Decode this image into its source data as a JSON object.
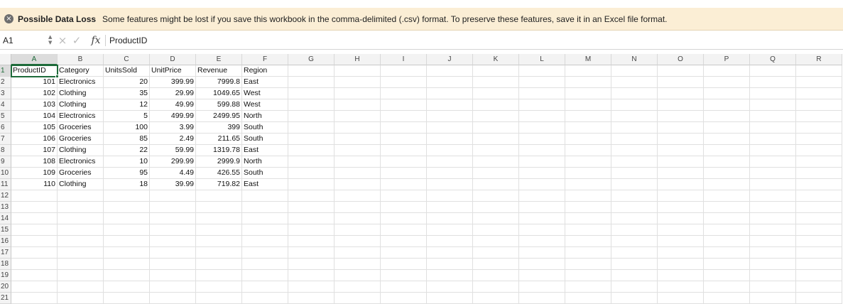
{
  "message_bar": {
    "icon": "close-circle-icon",
    "title": "Possible Data Loss",
    "text": "Some features might be lost if you save this workbook in the comma-delimited (.csv) format. To preserve these features, save it in an Excel file format."
  },
  "formula_bar": {
    "name_box": "A1",
    "cancel_icon": "×",
    "enter_icon": "✓",
    "fx_label": "fx",
    "content": "ProductID"
  },
  "columns": [
    "A",
    "B",
    "C",
    "D",
    "E",
    "F",
    "G",
    "H",
    "I",
    "J",
    "K",
    "L",
    "M",
    "N",
    "O",
    "P",
    "Q",
    "R"
  ],
  "rows": [
    "1",
    "2",
    "3",
    "4",
    "5",
    "6",
    "7",
    "8",
    "9",
    "10",
    "11",
    "12",
    "13",
    "14",
    "15",
    "16",
    "17",
    "18",
    "19",
    "20",
    "21"
  ],
  "table": {
    "headers": [
      "ProductID",
      "Category",
      "UnitsSold",
      "UnitPrice",
      "Revenue",
      "Region"
    ],
    "data": [
      [
        "101",
        "Electronics",
        "20",
        "399.99",
        "7999.8",
        "East"
      ],
      [
        "102",
        "Clothing",
        "35",
        "29.99",
        "1049.65",
        "West"
      ],
      [
        "103",
        "Clothing",
        "12",
        "49.99",
        "599.88",
        "West"
      ],
      [
        "104",
        "Electronics",
        "5",
        "499.99",
        "2499.95",
        "North"
      ],
      [
        "105",
        "Groceries",
        "100",
        "3.99",
        "399",
        "South"
      ],
      [
        "106",
        "Groceries",
        "85",
        "2.49",
        "211.65",
        "South"
      ],
      [
        "107",
        "Clothing",
        "22",
        "59.99",
        "1319.78",
        "East"
      ],
      [
        "108",
        "Electronics",
        "10",
        "299.99",
        "2999.9",
        "North"
      ],
      [
        "109",
        "Groceries",
        "95",
        "4.49",
        "426.55",
        "South"
      ],
      [
        "110",
        "Clothing",
        "18",
        "39.99",
        "719.82",
        "East"
      ]
    ]
  },
  "colors": {
    "accent": "#1e6b3a",
    "message_bg": "#fbeed5"
  }
}
